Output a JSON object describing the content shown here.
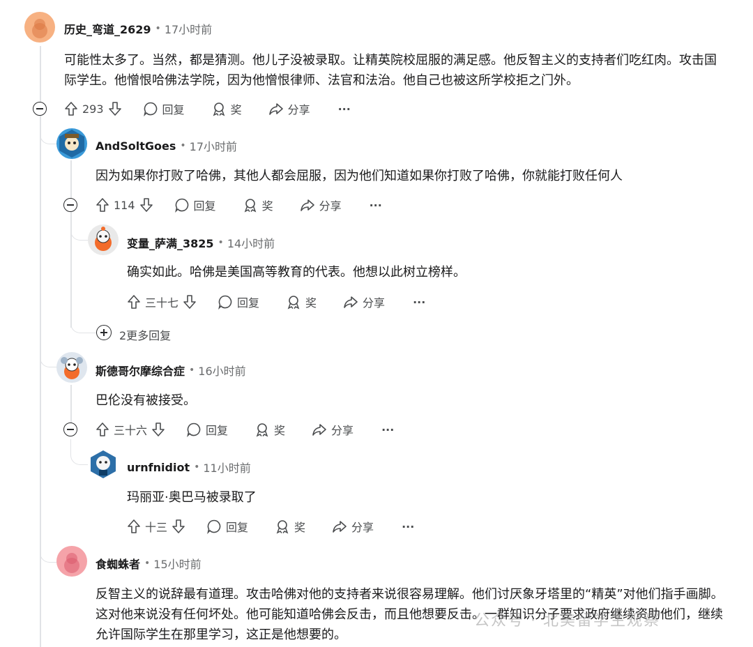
{
  "comments": [
    {
      "user": "历史_弯道_2629",
      "time": "17小时前",
      "text": "可能性太多了。当然，都是猜测。他儿子没被录取。让精英院校屈服的满足感。他反智主义的支持者们吃红肉。攻击国际学生。他憎恨哈佛法学院，因为他憎恨律师、法官和法治。他自己也被这所学校拒之门外。",
      "score": "293",
      "avatar_color": "#f7b182"
    },
    {
      "user": "AndSoltGoes",
      "time": "17小时前",
      "text": "因为如果你打败了哈佛，其他人都会屈服，因为他们知道如果你打败了哈佛，你就能打败任何人",
      "score": "114",
      "avatar_color": "#3a9ad9"
    },
    {
      "user": "变量_萨满_3825",
      "time": "14小时前",
      "text": "确实如此。哈佛是美国高等教育的代表。他想以此树立榜样。",
      "score": "三十七",
      "avatar_color": "#f36c2b"
    },
    {
      "user": "斯德哥尔摩综合症",
      "time": "16小时前",
      "text": "巴伦没有被接受。",
      "score": "三十六",
      "avatar_color": "#9fb3c8"
    },
    {
      "user": "urnfnidiot",
      "time": "11小时前",
      "text": "玛丽亚·奥巴马被录取了",
      "score": "十三",
      "avatar_color": "#2d6fa8"
    },
    {
      "user": "食蜘蛛者",
      "time": "15小时前",
      "text": "反智主义的说辞最有道理。攻击哈佛对他的支持者来说很容易理解。他们讨厌象牙塔里的“精英”对他们指手画脚。这对他来说没有任何坏处。他可能知道哈佛会反击，而且他想要反击。一群知识分子要求政府继续资助他们，继续允许国际学生在那里学习，这正是他想要的。",
      "avatar_color": "#f5a3a9"
    }
  ],
  "actions": {
    "reply": "回复",
    "award": "奖",
    "share": "分享",
    "more": "···"
  },
  "more_replies": "2更多回复",
  "watermark": "公众号 · 北美留学生观察"
}
